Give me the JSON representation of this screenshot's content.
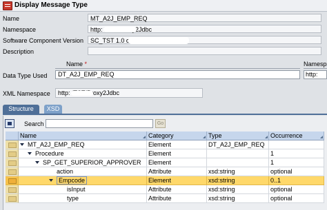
{
  "window": {
    "title": "Display Message Type"
  },
  "properties": [
    {
      "label": "Name",
      "value": "MT_A2J_EMP_REQ"
    },
    {
      "label": "Namespace",
      "value": "http:              /TST/Proxy2Jdbc"
    },
    {
      "label": "Software Component Version",
      "value": "SC_TST 1.0 c                        n"
    },
    {
      "label": "Description",
      "value": ""
    }
  ],
  "data_type": {
    "label": "Data Type Used",
    "name_header": "Name",
    "required_mark": "*",
    "namespace_header": "Namespac",
    "name_value": "DT_A2J_EMP_REQ",
    "namespace_value": "http:"
  },
  "xml_namespace": {
    "label": "XML Namespace",
    "value": "http:              /TST/Proxy2Jdbc"
  },
  "tabs": [
    {
      "label": "Structure"
    },
    {
      "label": "XSD"
    }
  ],
  "toolbar": {
    "search_label": "Search",
    "search_value": "",
    "go_label": "Go"
  },
  "table": {
    "columns": [
      "Name",
      "Category",
      "Type",
      "Occurrence"
    ],
    "rows": [
      {
        "name": "MT_A2J_EMP_REQ",
        "category": "Element",
        "type": "DT_A2J_EMP_REQ",
        "occurrence": "",
        "expanded": true,
        "selected": false
      },
      {
        "name": "Procedure",
        "category": "Element",
        "type": "",
        "occurrence": "1",
        "expanded": true,
        "selected": false
      },
      {
        "name": "SP_GET_SUPERIOR_APPROVER",
        "category": "Element",
        "type": "",
        "occurrence": "1",
        "expanded": true,
        "selected": false
      },
      {
        "name": "action",
        "category": "Attribute",
        "type": "xsd:string",
        "occurrence": "optional",
        "expanded": false,
        "selected": false
      },
      {
        "name": "Empcode",
        "category": "Element",
        "type": "xsd:string",
        "occurrence": "0..1",
        "expanded": true,
        "selected": true
      },
      {
        "name": "isInput",
        "category": "Attribute",
        "type": "xsd:string",
        "occurrence": "optional",
        "expanded": false,
        "selected": false
      },
      {
        "name": "type",
        "category": "Attribute",
        "type": "xsd:string",
        "occurrence": "optional",
        "expanded": false,
        "selected": false
      }
    ]
  }
}
